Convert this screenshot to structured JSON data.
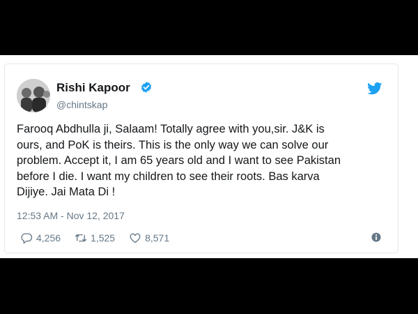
{
  "tweet": {
    "author_name": "Rishi Kapoor",
    "handle": "@chintskap",
    "text_lines": [
      "Farooq Abdhulla ji, Salaam! Totally agree with you,sir. J&K is",
      "ours, and PoK is theirs. This is the only way we can solve our",
      "problem. Accept it, I am 65 years old and I want to see Pakistan",
      "before I die. I want my children to see their roots. Bas karva",
      "Dijiye. Jai Mata Di !"
    ],
    "timestamp": "12:53 AM - Nov 12, 2017",
    "stats": {
      "replies": "4,256",
      "retweets": "1,525",
      "likes": "8,571"
    }
  },
  "icons": {
    "verified": "verified-badge-icon",
    "brand": "twitter-bird-icon",
    "reply": "reply-icon",
    "retweet": "retweet-icon",
    "like": "heart-icon",
    "info": "info-icon"
  },
  "colors": {
    "twitter_blue": "#1da1f2",
    "text": "#14171a",
    "muted": "#657786",
    "border": "#e1e8ed",
    "letterbox": "#000000"
  }
}
